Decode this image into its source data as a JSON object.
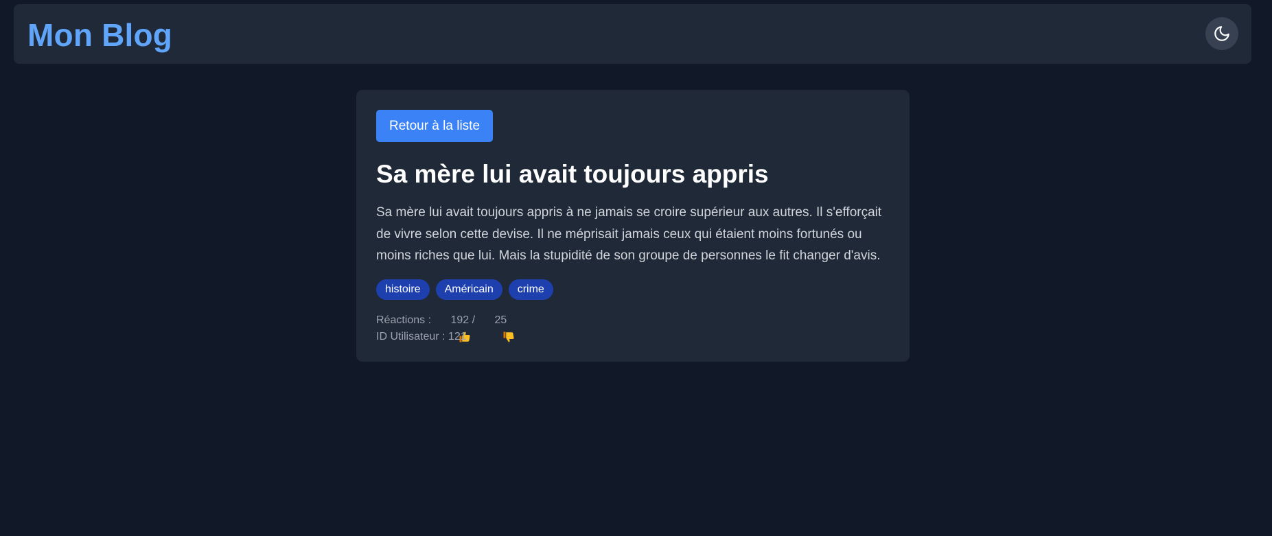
{
  "header": {
    "title": "Mon Blog",
    "theme_toggle_icon": "moon-icon"
  },
  "post": {
    "back_label": "Retour à la liste",
    "title": "Sa mère lui avait toujours appris",
    "body": "Sa mère lui avait toujours appris à ne jamais se croire supérieur aux autres. Il s'efforçait de vivre selon cette devise. Il ne méprisait jamais ceux qui étaient moins fortunés ou moins riches que lui. Mais la stupidité de son groupe de personnes le fit changer d'avis.",
    "tags": [
      "histoire",
      "Américain",
      "crime"
    ],
    "reactions_label": "Réactions : ",
    "likes": "192",
    "separator": " / ",
    "dislikes": "25",
    "user_id_label": "ID Utilisateur : 121"
  },
  "colors": {
    "background": "#111827",
    "surface": "#1f2937",
    "accent": "#3b82f6",
    "logo": "#60a5fa",
    "tag": "#1e40af"
  }
}
